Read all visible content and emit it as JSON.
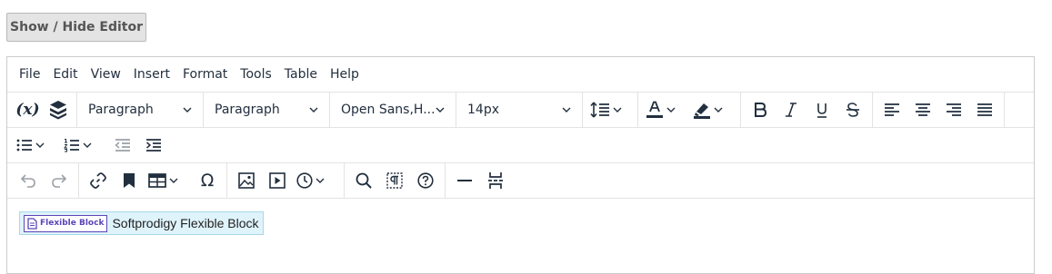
{
  "toggle_button": "Show / Hide Editor",
  "menubar": [
    "File",
    "Edit",
    "View",
    "Insert",
    "Format",
    "Tools",
    "Table",
    "Help"
  ],
  "toolbar": {
    "variables_label": "(x)",
    "block_format": "Paragraph",
    "paragraph_style": "Paragraph",
    "font_family": "Open Sans,H...",
    "font_size": "14px"
  },
  "content": {
    "block_logo": "Flexible Block",
    "block_text": "Softprodigy Flexible Block"
  },
  "colors": {
    "text_color_bar": "#222f3e",
    "highlight_bar": "#222f3e",
    "block_bg": "#dff3fb",
    "block_logo": "#5b45b8"
  }
}
